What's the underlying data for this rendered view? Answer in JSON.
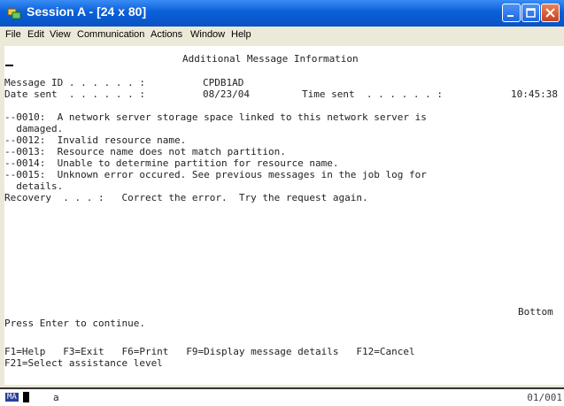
{
  "window": {
    "title": "Session A - [24 x 80]",
    "titlebar_color": "#0a5fd8"
  },
  "menu": [
    "File",
    "Edit",
    "View",
    "Communication",
    "Actions",
    "Window",
    "Help"
  ],
  "screen": {
    "heading": "Additional Message Information",
    "message_id_label": "Message ID . . . . . . :",
    "message_id": "CPDB1AD",
    "date_sent_label": "Date sent  . . . . . . :",
    "date_sent": "08/23/04",
    "time_sent_label": "Time sent  . . . . . . :",
    "time_sent": "10:45:38",
    "body": [
      "--0010:  A network server storage space linked to this network server is",
      "  damaged.",
      "--0012:  Invalid resource name.",
      "--0013:  Resource name does not match partition.",
      "--0014:  Unable to determine partition for resource name.",
      "--0015:  Unknown error occured. See previous messages in the job log for",
      "  details.",
      "Recovery  . . . :   Correct the error.  Try the request again."
    ],
    "bottom_indicator": "Bottom",
    "press_enter": "Press Enter to continue.",
    "function_keys_1": "F1=Help   F3=Exit   F6=Print   F9=Display message details   F12=Cancel",
    "function_keys_2": "F21=Select assistance level"
  },
  "status": {
    "mode": "MA",
    "indicator": "a",
    "cursor_position": "01/001"
  }
}
